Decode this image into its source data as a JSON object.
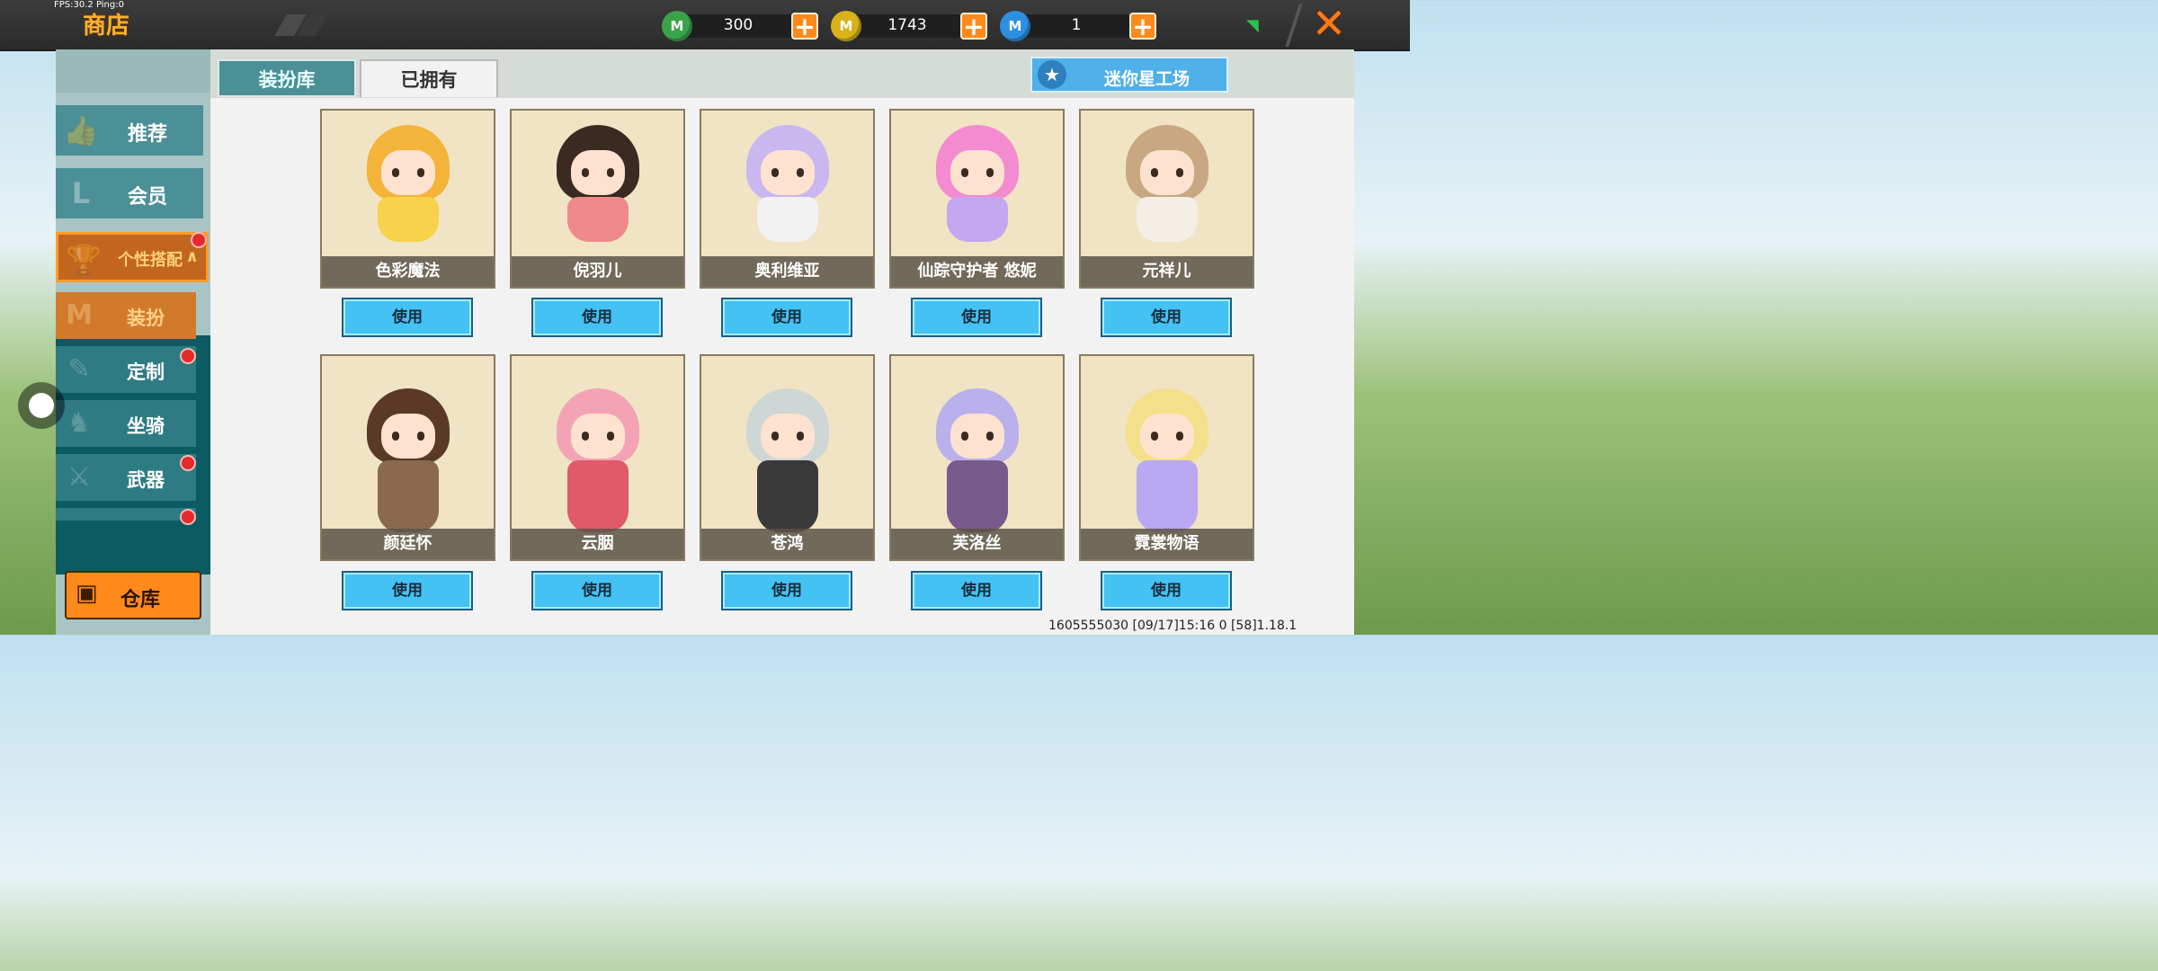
{
  "fps_text": "FPS:30.2  Ping:0",
  "header": {
    "title": "商店"
  },
  "currencies": [
    {
      "name": "green-m-coin-icon",
      "color": "#3aa34a",
      "glyph": "M",
      "value": "300"
    },
    {
      "name": "gold-m-coin-icon",
      "color": "#d8b21a",
      "glyph": "M",
      "value": "1743"
    },
    {
      "name": "blue-m-coin-icon",
      "color": "#2d8fe0",
      "glyph": "M",
      "value": "1"
    }
  ],
  "plus_glyph": "+",
  "close_glyph": "✕",
  "signal_glyph": "◥",
  "sidebar": {
    "items": [
      {
        "label": "推荐",
        "icon": "thumbs-up-icon",
        "glyph": "👍"
      },
      {
        "label": "会员",
        "icon": "member-icon",
        "glyph": "L"
      },
      {
        "label": "个性搭配",
        "icon": "trophy-icon",
        "glyph": "🏆"
      }
    ],
    "sub_items": [
      {
        "label": "装扮",
        "icon": "outfit-icon",
        "glyph": "M"
      },
      {
        "label": "定制",
        "icon": "customize-icon",
        "glyph": "✎"
      },
      {
        "label": "坐骑",
        "icon": "mount-icon",
        "glyph": "♞"
      },
      {
        "label": "武器",
        "icon": "weapon-icon",
        "glyph": "⚔"
      }
    ],
    "warehouse_label": "仓库",
    "warehouse_glyph": "▣"
  },
  "tabs": {
    "wardrobe": "装扮库",
    "owned": "已拥有"
  },
  "workshop": {
    "label": "迷你星工场",
    "glyph": "★"
  },
  "costumes": [
    {
      "name": "色彩魔法",
      "use_label": "使用",
      "hair": "#f4b43a",
      "dress": "#f7d24a"
    },
    {
      "name": "倪羽儿",
      "use_label": "使用",
      "hair": "#3a2a22",
      "dress": "#f08a8a"
    },
    {
      "name": "奥利维亚",
      "use_label": "使用",
      "hair": "#c9b7f0",
      "dress": "#f2f2f2"
    },
    {
      "name": "仙踪守护者 悠妮",
      "use_label": "使用",
      "hair": "#f48ad0",
      "dress": "#c6a6f0"
    },
    {
      "name": "元祥儿",
      "use_label": "使用",
      "hair": "#c8a882",
      "dress": "#f3efe6"
    },
    {
      "name": "颜廷怀",
      "use_label": "使用",
      "hair": "#5a3a26",
      "dress": "#8a6a4e"
    },
    {
      "name": "云胭",
      "use_label": "使用",
      "hair": "#f4a3b6",
      "dress": "#e05a6a"
    },
    {
      "name": "苍鸿",
      "use_label": "使用",
      "hair": "#cfd6d6",
      "dress": "#3a3a3a"
    },
    {
      "name": "芙洛丝",
      "use_label": "使用",
      "hair": "#b9b0ec",
      "dress": "#7a5a8a"
    },
    {
      "name": "霓裳物语",
      "use_label": "使用",
      "hair": "#f4e08a",
      "dress": "#b9a8f2"
    }
  ],
  "footer": "1605555030   [09/17]15:16 0    [58]1.18.1"
}
